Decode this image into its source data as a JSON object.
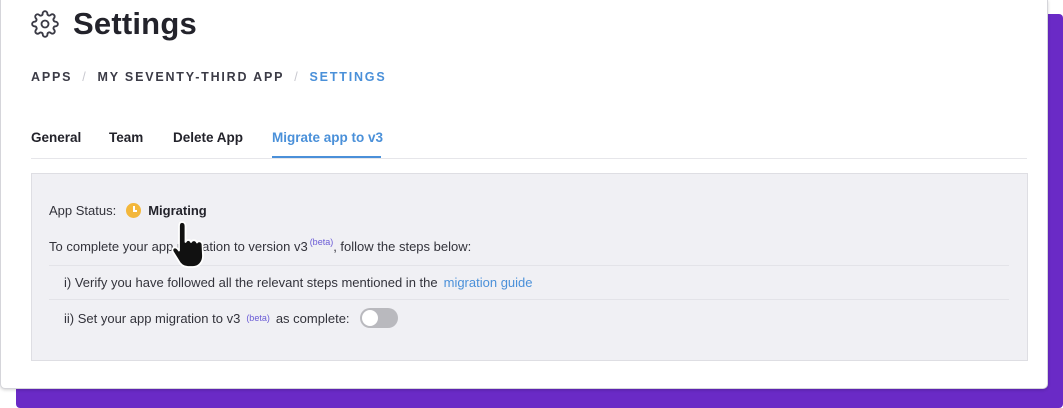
{
  "header": {
    "title": "Settings",
    "icon": "gear-icon"
  },
  "breadcrumb": {
    "items": [
      "APPS",
      "MY SEVENTY-THIRD APP",
      "SETTINGS"
    ],
    "separator": "/"
  },
  "tabs": [
    {
      "label": "General",
      "active": false
    },
    {
      "label": "Team",
      "active": false
    },
    {
      "label": "Delete App",
      "active": false
    },
    {
      "label": "Migrate app to v3",
      "active": true
    }
  ],
  "panel": {
    "status_label": "App Status:",
    "status_value": "Migrating",
    "status_icon": "clock-icon",
    "instruction_prefix": "To complete your app migration to version v3",
    "instruction_beta": "(beta)",
    "instruction_suffix": ", follow the steps below:",
    "step1_text": "i) Verify you have followed all the relevant steps mentioned in the",
    "step1_link": "migration guide",
    "step2_prefix": "ii) Set your app migration to v3",
    "step2_beta": "(beta)",
    "step2_suffix": "as complete:",
    "toggle_on": false
  },
  "colors": {
    "accent": "#4a90d9",
    "status": "#f3b73b",
    "backdrop": "#6a2ac6",
    "beta": "#6a5bd6"
  }
}
